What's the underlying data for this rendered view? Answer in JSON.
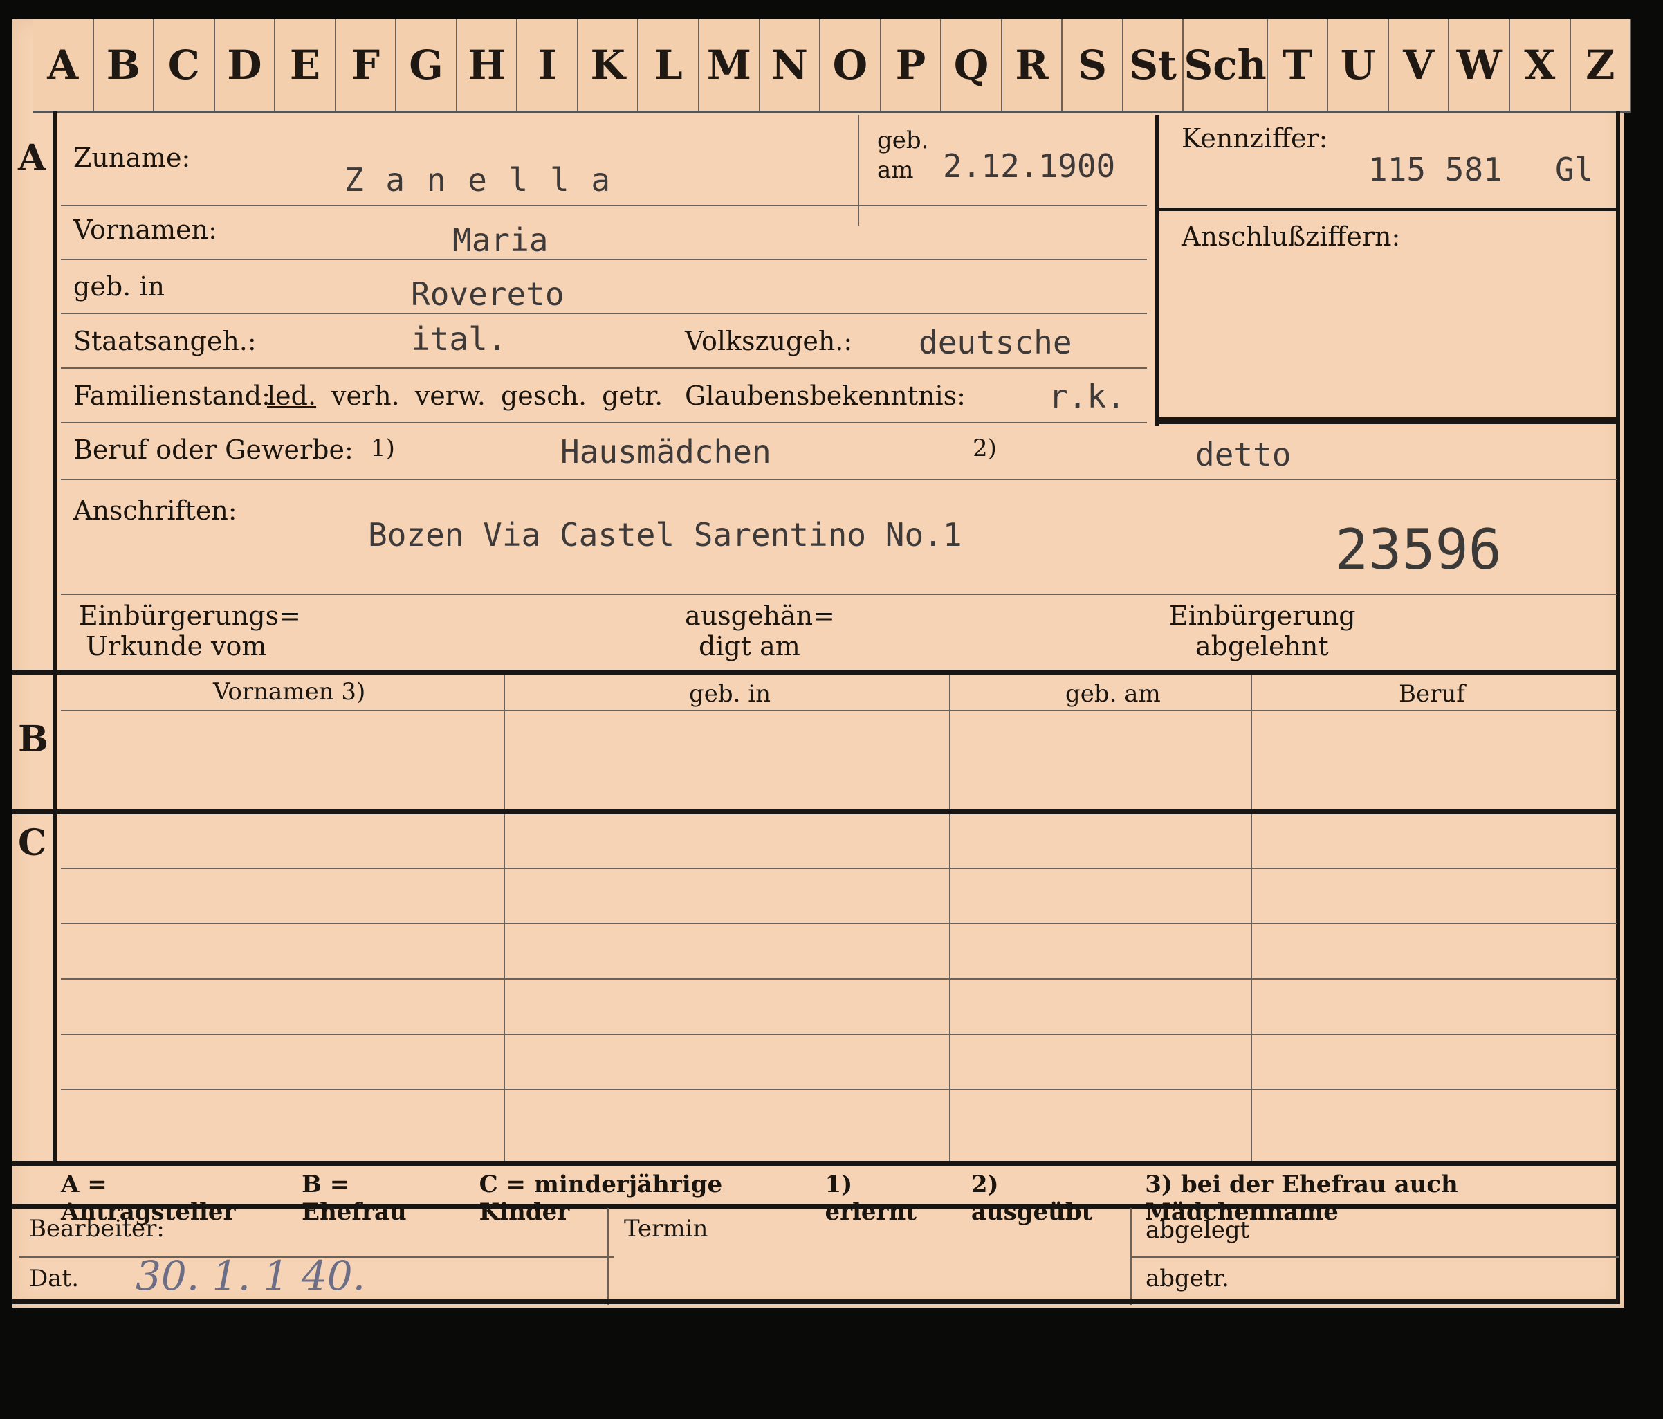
{
  "index_tabs": [
    "A",
    "B",
    "C",
    "D",
    "E",
    "F",
    "G",
    "H",
    "I",
    "K",
    "L",
    "M",
    "N",
    "O",
    "P",
    "Q",
    "R",
    "S",
    "St",
    "Sch",
    "T",
    "U",
    "V",
    "W",
    "X",
    "Z"
  ],
  "sections": {
    "a": "A",
    "b": "B",
    "c": "C"
  },
  "labels": {
    "zuname": "Zuname:",
    "geb_am_1": "geb.",
    "geb_am_2": "am",
    "kennziffer": "Kennziffer:",
    "anschlussziffern": "Anschlußziffern:",
    "vornamen": "Vornamen:",
    "geb_in": "geb. in",
    "staatsangeh": "Staatsangeh.:",
    "volkszugeh": "Volkszugeh.:",
    "familienstand": "Familienstand:",
    "fam_options": [
      "led.",
      "verh.",
      "verw.",
      "gesch.",
      "getr."
    ],
    "glaubensbekenntnis": "Glaubensbekenntnis:",
    "beruf": "Beruf oder Gewerbe:",
    "fn1": "1)",
    "fn2": "2)",
    "anschriften": "Anschriften:",
    "einb_urkunde_1": "Einbürgerungs=",
    "einb_urkunde_2": "Urkunde vom",
    "ausgehaendigt_1": "ausgehän=",
    "ausgehaendigt_2": "digt am",
    "einb_abgelehnt_1": "Einbürgerung",
    "einb_abgelehnt_2": "abgelehnt"
  },
  "values": {
    "zuname": "Z a n e l l a",
    "geb_am": "2.12.1900",
    "kennziffer": "115 581",
    "kennziffer_suffix": "Gl",
    "vornamen": "Maria",
    "geb_in": "Rovereto",
    "staatsangeh": "ital.",
    "volkszugeh": "deutsche",
    "glaubensbekenntnis": "r.k.",
    "beruf_erlernt": "Hausmädchen",
    "beruf_ausgeuebt": "detto",
    "anschrift": "Bozen Via Castel Sarentino No.1",
    "stamp_number": "23596"
  },
  "table_b_headers": [
    "Vornamen 3)",
    "geb. in",
    "geb. am",
    "Beruf"
  ],
  "legend": {
    "a": "A = Antragsteller",
    "b": "B = Ehefrau",
    "c": "C = minderjährige Kinder",
    "fn1": "1) erlernt",
    "fn2": "2) ausgeübt",
    "fn3": "3) bei der Ehefrau auch Mädchenname"
  },
  "footer": {
    "bearbeiter": "Bearbeiter:",
    "dat": "Dat.",
    "dat_value": "30. 1. 1 40.",
    "termin": "Termin",
    "abgelegt": "abgelegt",
    "abgetr": "abgetr."
  }
}
